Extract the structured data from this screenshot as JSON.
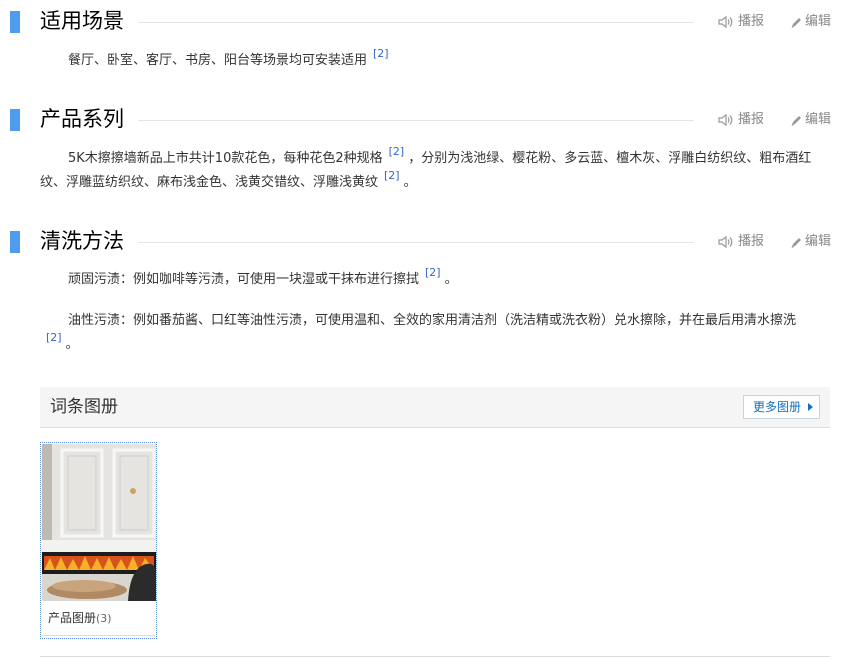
{
  "sections": [
    {
      "title": "适用场景",
      "play_label": "播报",
      "edit_label": "编辑",
      "paragraphs": [
        {
          "segments": [
            "餐厅、卧室、客厅、书房、阳台等场景均可安装适用"
          ],
          "refs": [
            "[2]"
          ]
        }
      ]
    },
    {
      "title": "产品系列",
      "play_label": "播报",
      "edit_label": "编辑",
      "paragraphs": [
        {
          "segments": [
            "5K木擦擦墙新品上市共计10款花色，每种花色2种规格",
            "，分别为浅池绿、樱花粉、多云蓝、檀木灰、浮雕白纺织纹、粗布酒红纹、浮雕蓝纺织纹、麻布浅金色、浅黄交错纹、浮雕浅黄纹",
            "。"
          ],
          "refs": [
            "[2]",
            "[2]"
          ]
        }
      ]
    },
    {
      "title": "清洗方法",
      "play_label": "播报",
      "edit_label": "编辑",
      "paragraphs": [
        {
          "segments": [
            "顽固污渍：例如咖啡等污渍，可使用一块湿或干抹布进行擦拭",
            "。"
          ],
          "refs": [
            "[2]"
          ]
        },
        {
          "segments": [
            "油性污渍：例如番茄酱、口红等油性污渍，可使用温和、全效的家用清洁剂（洗洁精或洗衣粉）兑水擦除，并在最后用清水擦洗",
            "。"
          ],
          "refs": [
            "[2]"
          ]
        }
      ]
    }
  ],
  "album": {
    "title": "词条图册",
    "more_label": "更多图册",
    "cards": [
      {
        "caption": "产品图册",
        "count": "(3)"
      }
    ]
  },
  "icons": {
    "play": "speaker-icon",
    "edit": "pencil-icon",
    "more": "caret-right-icon"
  },
  "colors": {
    "accent_bar": "#4f9cee",
    "ref_link": "#3366cc",
    "more_link": "#136ec2"
  }
}
